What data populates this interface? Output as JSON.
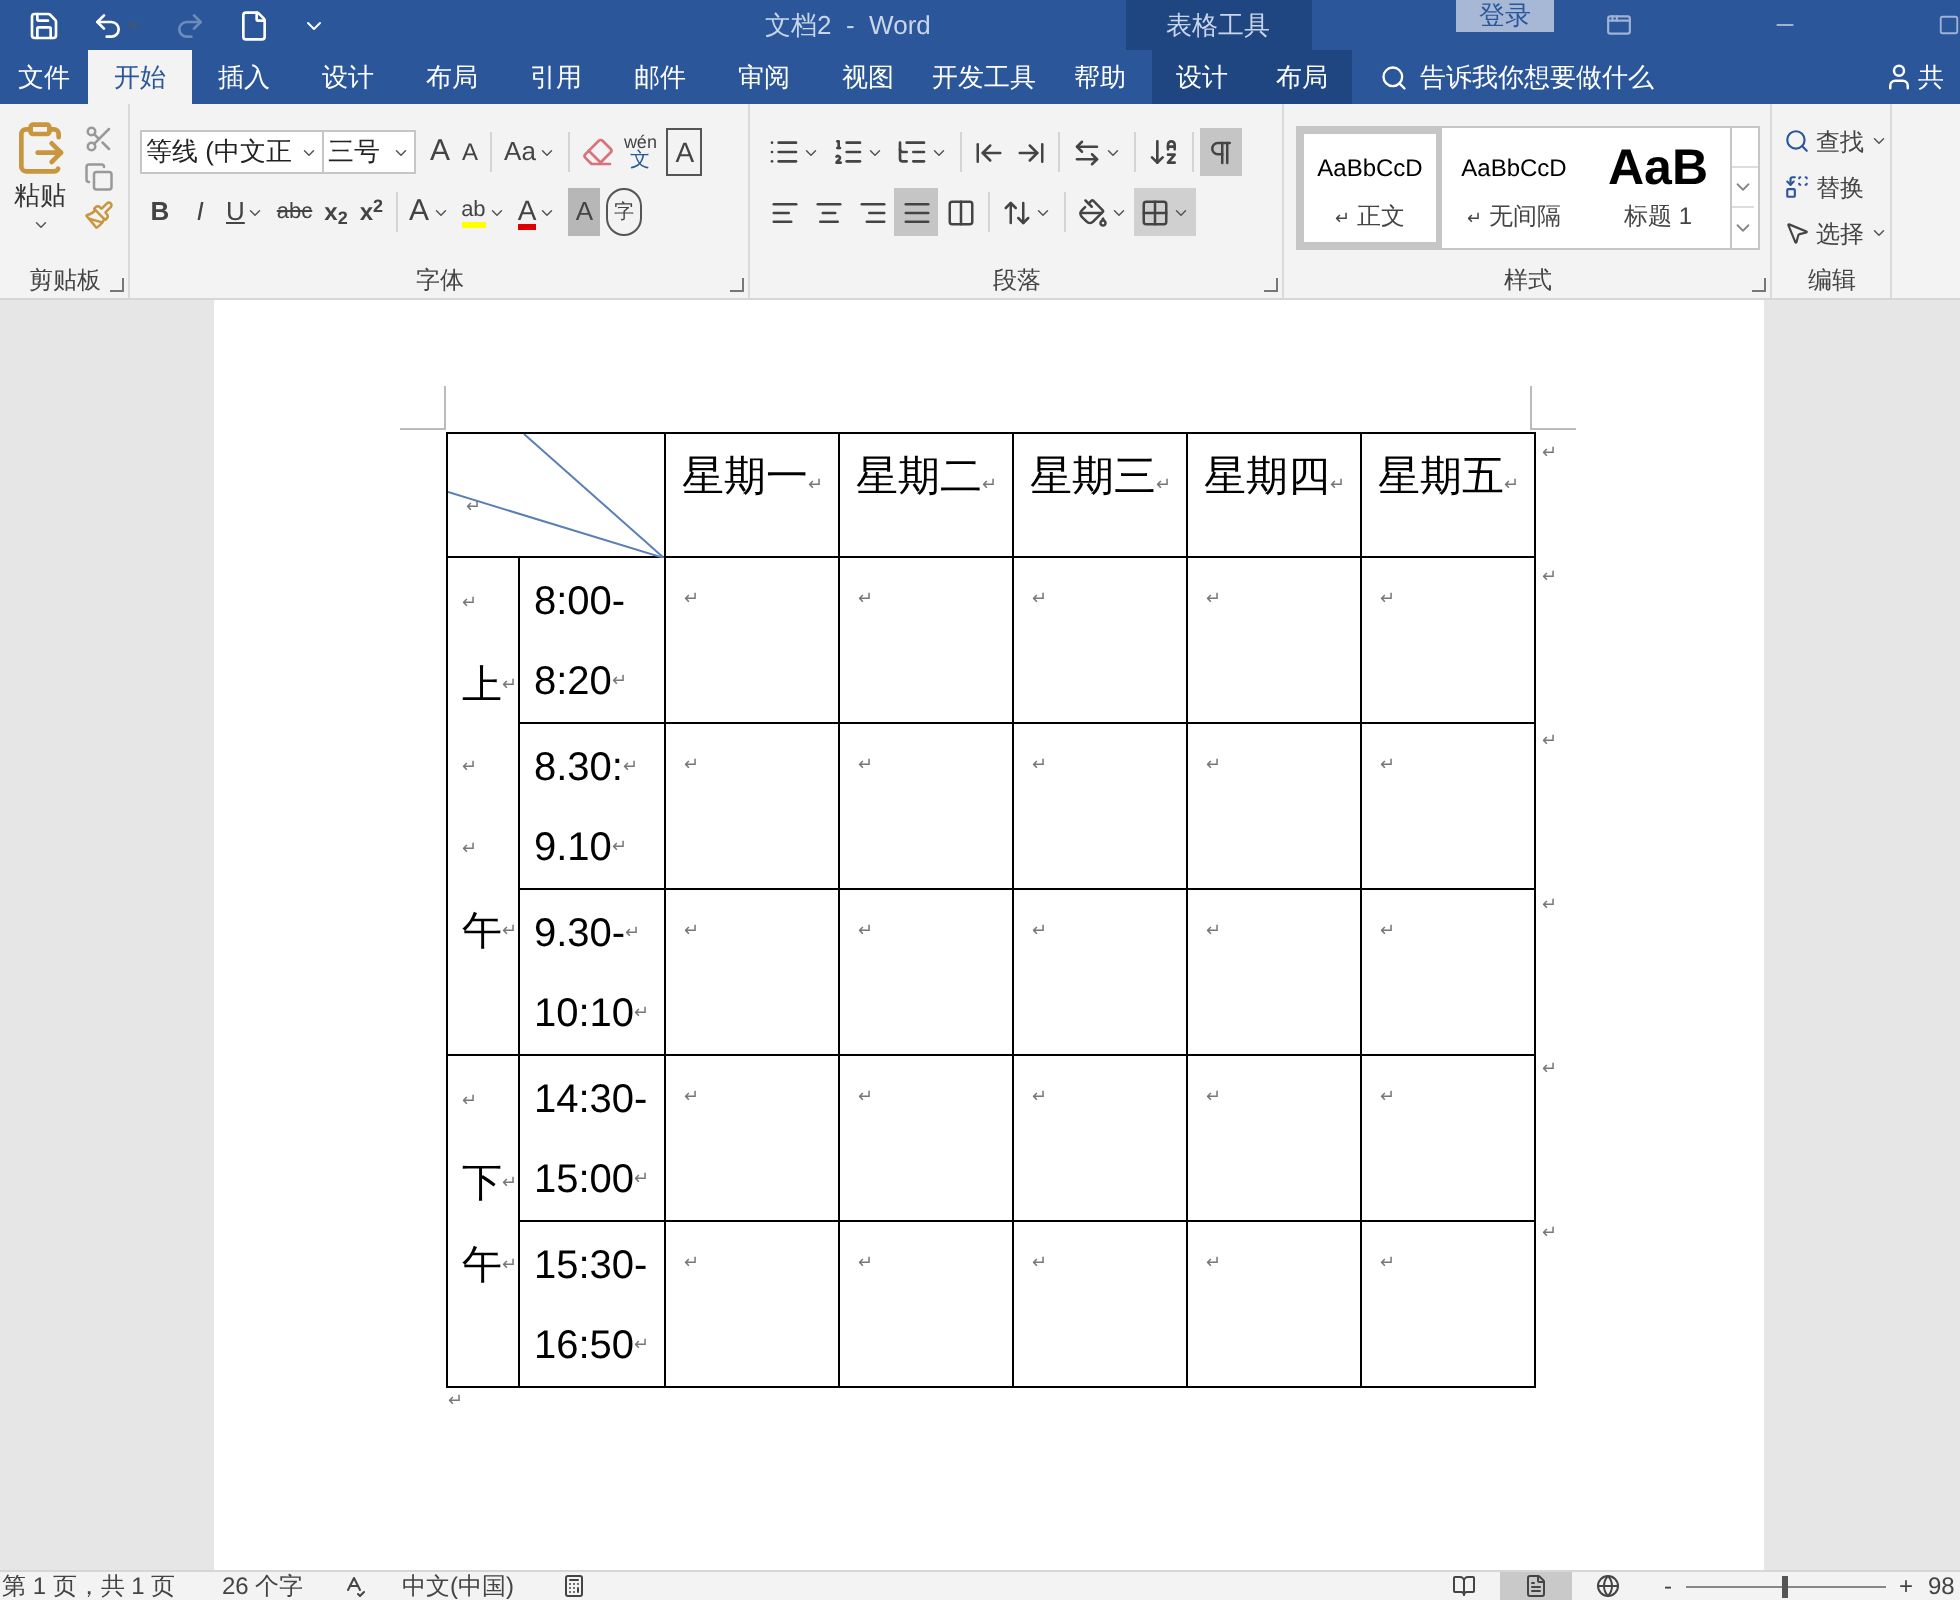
{
  "title_bar": {
    "title": "文档2  -  Word",
    "context_group": "表格工具",
    "sign_in": "登录"
  },
  "tabs": [
    {
      "label": "文件",
      "selected": false,
      "kind": "file"
    },
    {
      "label": "开始",
      "selected": true,
      "kind": "main"
    },
    {
      "label": "插入",
      "selected": false,
      "kind": "main"
    },
    {
      "label": "设计",
      "selected": false,
      "kind": "main"
    },
    {
      "label": "布局",
      "selected": false,
      "kind": "main"
    },
    {
      "label": "引用",
      "selected": false,
      "kind": "main"
    },
    {
      "label": "邮件",
      "selected": false,
      "kind": "main"
    },
    {
      "label": "审阅",
      "selected": false,
      "kind": "main"
    },
    {
      "label": "视图",
      "selected": false,
      "kind": "main"
    },
    {
      "label": "开发工具",
      "selected": false,
      "kind": "main"
    },
    {
      "label": "帮助",
      "selected": false,
      "kind": "main"
    },
    {
      "label": "设计",
      "selected": false,
      "kind": "contextual"
    },
    {
      "label": "布局",
      "selected": false,
      "kind": "contextual"
    }
  ],
  "tell_me": {
    "placeholder": "告诉我你想要做什么"
  },
  "share": "共",
  "ribbon": {
    "clipboard": {
      "label": "剪贴板",
      "paste": "粘贴"
    },
    "font": {
      "label": "字体",
      "font_name": "等线 (中文正",
      "font_size": "三号",
      "grow": "A",
      "shrink": "A",
      "change_case": "Aa",
      "phonetic_top": "wén",
      "phonetic_bottom": "文",
      "char_border": "A",
      "bold": "B",
      "italic": "I",
      "underline": "U",
      "strikethrough": "abc",
      "subscript": "x$_{2}$",
      "superscript": "x$^{2}$",
      "text_effects": "A",
      "highlight": "ab",
      "font_color": "A",
      "char_shading": "A",
      "enclose": "字"
    },
    "paragraph": {
      "label": "段落",
      "show_marks": true,
      "alignment": [
        {
          "selected": false
        },
        {
          "selected": false
        },
        {
          "selected": false
        },
        {
          "selected": true
        },
        {
          "selected": false
        }
      ]
    },
    "styles": {
      "label": "样式",
      "items": [
        {
          "preview": "AaBbCcD",
          "mark": "↵",
          "name": "正文",
          "selected": true,
          "kind": "body"
        },
        {
          "preview": "AaBbCcD",
          "mark": "↵",
          "name": "无间隔",
          "selected": false,
          "kind": "body"
        },
        {
          "preview": "AaB",
          "name": "标题 1",
          "selected": false,
          "kind": "heading"
        }
      ]
    },
    "editing": {
      "label": "编辑",
      "find": "查找",
      "replace": "替换",
      "select": "选择"
    }
  },
  "table": {
    "corner": "↵",
    "days": [
      "星期一↵",
      "星期二↵",
      "星期三↵",
      "星期四↵",
      "星期五↵"
    ],
    "row_end_marks": [
      "↵",
      "↵",
      "↵",
      "↵",
      "↵",
      "↵"
    ],
    "sessions": [
      {
        "lines": [
          "↵",
          "上↵",
          "↵",
          "↵",
          "午↵"
        ],
        "slots": [
          {
            "time_lines": [
              "8:00-",
              "8:20↵"
            ],
            "cells": [
              "↵",
              "↵",
              "↵",
              "↵",
              "↵"
            ]
          },
          {
            "time_lines": [
              "8.30:↵",
              "9.10↵"
            ],
            "cells": [
              "↵",
              "↵",
              "↵",
              "↵",
              "↵"
            ]
          },
          {
            "time_lines": [
              "9.30-↵",
              "10:10↵"
            ],
            "cells": [
              "↵",
              "↵",
              "↵",
              "↵",
              "↵"
            ]
          }
        ]
      },
      {
        "lines": [
          "↵",
          "下↵",
          "午↵"
        ],
        "slots": [
          {
            "time_lines": [
              "14:30-",
              "15:00↵"
            ],
            "cells": [
              "↵",
              "↵",
              "↵",
              "↵",
              "↵"
            ]
          },
          {
            "time_lines": [
              "15:30-",
              "16:50↵"
            ],
            "cells": [
              "↵",
              "↵",
              "↵",
              "↵",
              "↵"
            ]
          }
        ]
      }
    ]
  },
  "after_table": "↵",
  "status_bar": {
    "page": "第 1 页，共 1 页",
    "words": "26 个字",
    "language": "中文(中国)",
    "views": [
      {
        "selected": false
      },
      {
        "selected": true
      },
      {
        "selected": false
      }
    ],
    "zoom_out": "-",
    "zoom_in": "+",
    "zoom": {
      "level": 0.49
    },
    "zoom_reading": "98"
  }
}
